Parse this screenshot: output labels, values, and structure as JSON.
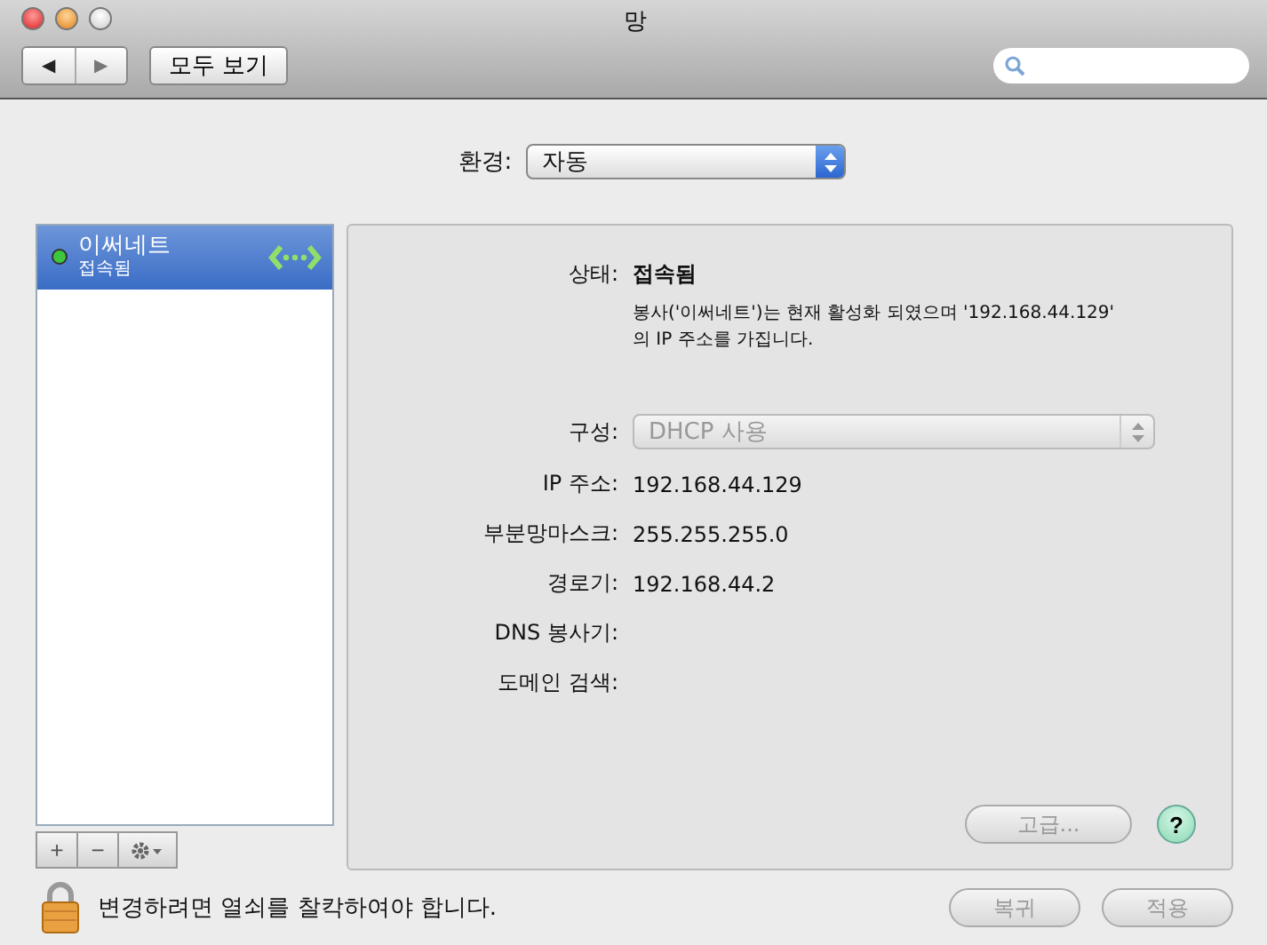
{
  "window": {
    "title": "망"
  },
  "toolbar": {
    "back": "◀",
    "forward": "▶",
    "show_all": "모두 보기"
  },
  "location": {
    "label": "환경:",
    "value": "자동"
  },
  "services": [
    {
      "name": "이써네트",
      "status": "접속됨",
      "selected": true,
      "color": "#3cc83c"
    }
  ],
  "detail": {
    "status_label": "상태:",
    "status_value": "접속됨",
    "description": "봉사('이써네트')는 현재 활성화 되였으며 '192.168.44.129' 의 IP 주소를 가집니다.",
    "config": {
      "label": "구성:",
      "value": "DHCP 사용",
      "disabled": true
    },
    "fields": [
      {
        "label": "IP 주소:",
        "value": "192.168.44.129"
      },
      {
        "label": "부분망마스크:",
        "value": "255.255.255.0"
      },
      {
        "label": "경로기:",
        "value": "192.168.44.2"
      },
      {
        "label": "DNS 봉사기:"
      },
      {
        "label": "도메인 검색:"
      }
    ],
    "advanced_button": {
      "label": "고급...",
      "disabled": true
    },
    "help": "?"
  },
  "list_buttons": {
    "add": "+",
    "remove": "−"
  },
  "footer": {
    "lock_message": "변경하려면 열쇠를 찰칵하여야 합니다.",
    "buttons": [
      {
        "label": "복귀",
        "disabled": true
      },
      {
        "label": "적용",
        "disabled": true
      }
    ]
  }
}
